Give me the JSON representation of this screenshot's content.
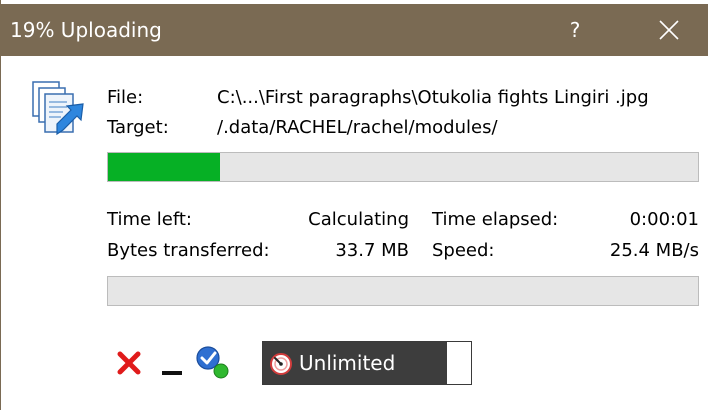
{
  "window": {
    "title": "19% Uploading",
    "help_label": "?",
    "title_color": "#7a6a53"
  },
  "transfer": {
    "file_label": "File:",
    "file_value": "C:\\...\\First paragraphs\\Otukolia fights Lingiri .jpg",
    "target_label": "Target:",
    "target_value": "/.data/RACHEL/rachel/modules/",
    "file_progress_percent": 19,
    "progress_color": "#06b025"
  },
  "stats": {
    "time_left_label": "Time left:",
    "time_left_value": "Calculating",
    "time_elapsed_label": "Time elapsed:",
    "time_elapsed_value": "0:00:01",
    "bytes_label": "Bytes transferred:",
    "bytes_value": "33.7 MB",
    "speed_label": "Speed:",
    "speed_value": "25.4 MB/s"
  },
  "total_progress_percent": 0,
  "toolbar": {
    "cancel_icon": "red-x-icon",
    "minimize_icon": "minimize-icon",
    "transfer_done_icon": "check-globe-icon",
    "speed_limit_icon": "speedometer-icon",
    "speed_limit_label": "Unlimited"
  }
}
